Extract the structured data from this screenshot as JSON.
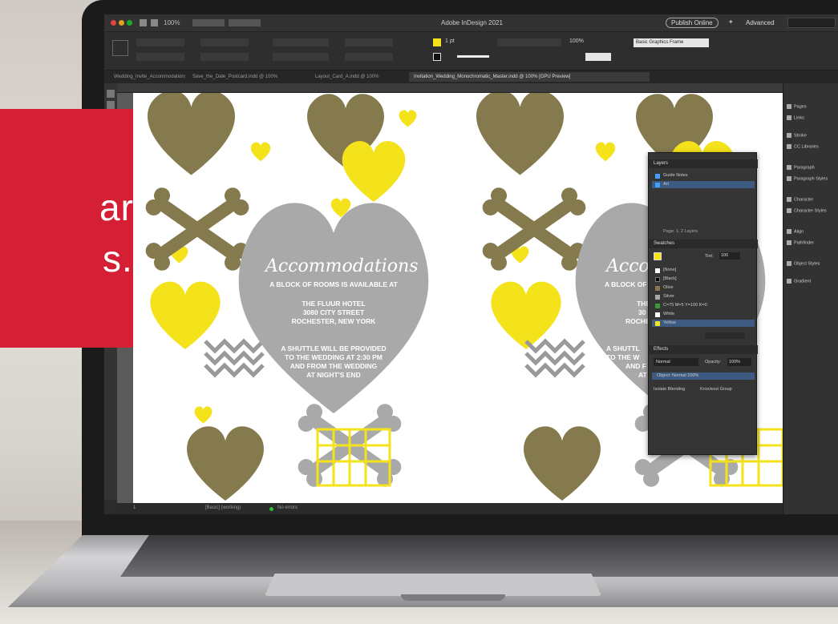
{
  "overlay": {
    "line1": "ar",
    "line2": "s."
  },
  "app": {
    "window_title": "Adobe InDesign 2021",
    "publish_button": "Publish Online",
    "workspace": "Advanced",
    "zoom": "100%",
    "paragraph_style": "Basic Graphics Frame",
    "stroke_weight": "1 pt",
    "opacity": "100%"
  },
  "tabs": [
    {
      "label": "Wedding_Invite_Accommodations.indd @ 100%"
    },
    {
      "label": "Save_the_Date_Postcard.indd @ 100%"
    },
    {
      "label": "Layout_Card_A.indd @ 100%"
    },
    {
      "label": "Invitation_Wedding_Monochromatic_Master.indd @ 100% [GPU Preview]"
    }
  ],
  "dock": [
    {
      "label": "Pages",
      "icon": "pages-icon"
    },
    {
      "label": "Links",
      "icon": "links-icon"
    },
    {
      "label": "Stroke",
      "icon": "stroke-icon"
    },
    {
      "label": "CC Libraries",
      "icon": "cc-libraries-icon"
    },
    {
      "label": "Paragraph",
      "icon": "paragraph-icon"
    },
    {
      "label": "Paragraph Styles",
      "icon": "paragraph-styles-icon"
    },
    {
      "label": "Character",
      "icon": "character-icon"
    },
    {
      "label": "Character Styles",
      "icon": "character-styles-icon"
    },
    {
      "label": "Align",
      "icon": "align-icon"
    },
    {
      "label": "Pathfinder",
      "icon": "pathfinder-icon"
    },
    {
      "label": "Object Styles",
      "icon": "object-styles-icon"
    },
    {
      "label": "Gradient",
      "icon": "gradient-icon"
    }
  ],
  "layers_panel": {
    "title": "Layers",
    "rows": [
      {
        "label": "Guide Notes",
        "color": "#3fa0ff"
      },
      {
        "label": "Art",
        "color": "#3fa0ff"
      }
    ],
    "footer": "Page: 1, 2 Layers"
  },
  "swatches_panel": {
    "title": "Swatches",
    "tint_label": "Tint:",
    "tint_value": "100",
    "rows": [
      {
        "label": "[None]",
        "color": "#ffffff"
      },
      {
        "label": "[Black]",
        "color": "#000000"
      },
      {
        "label": "Olive",
        "color": "#857a4e"
      },
      {
        "label": "Silver",
        "color": "#a9a9a9"
      },
      {
        "label": "C=75 M=5 Y=100 K=0",
        "color": "#3a9a3a"
      },
      {
        "label": "White",
        "color": "#ffffff"
      },
      {
        "label": "Yellow",
        "color": "#f4e21b"
      }
    ]
  },
  "effects_panel": {
    "title": "Effects",
    "blend_mode": "Normal",
    "opacity_label": "Opacity:",
    "opacity_value": "100%",
    "object_row": "Object: Normal 100%",
    "isolate_label": "Isolate Blending",
    "knockout_label": "Knockout Group"
  },
  "status": {
    "page": "1",
    "style": "[Basic] (working)",
    "errors": "No errors"
  },
  "design": {
    "heading": "Accommodations",
    "sub": "A BLOCK OF ROOMS IS AVAILABLE AT",
    "hotel_1": "THE FLUUR HOTEL",
    "hotel_2": "3080 CITY STREET",
    "hotel_3": "ROCHESTER, NEW YORK",
    "shuttle_1": "A SHUTTLE WILL BE PROVIDED",
    "shuttle_2": "TO THE WEDDING AT 2:30 PM",
    "shuttle_3": "AND FROM THE WEDDING",
    "shuttle_4": "AT NIGHT'S END",
    "heading_2": "Acco",
    "sub_2": "A BLOCK OF",
    "hotel_2a": "THE",
    "hotel_2b": "30",
    "hotel_2c": "ROCHE",
    "shuttle_2a": "A SHUTTL",
    "shuttle_2b": "TO THE W",
    "shuttle_2c": "AND F",
    "shuttle_2d": "AT"
  },
  "colors": {
    "red_card": "#d51f35",
    "olive": "#857a4e",
    "silver": "#a9a9a9",
    "yellow": "#f4e21b"
  }
}
